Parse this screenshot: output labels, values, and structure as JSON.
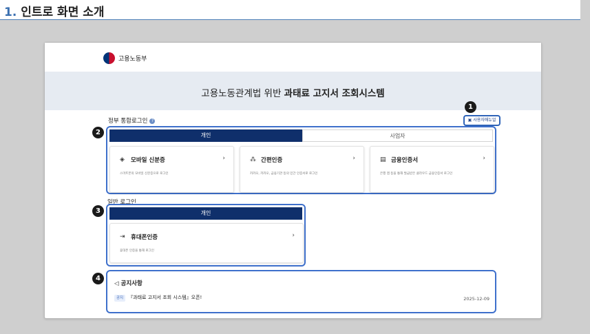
{
  "slide": {
    "number": "1.",
    "title": "인트로 화면 소개"
  },
  "header": {
    "logo_text": "고용노동부"
  },
  "banner": {
    "prefix": "고용노동관계법 위반 ",
    "emphasis": "과태료 고지서 조회시스템"
  },
  "gov_login": {
    "label": "정부 통합로그인",
    "help_icon": "?",
    "manual_link": "사용자매뉴얼",
    "tabs": [
      {
        "label": "개인",
        "active": true
      },
      {
        "label": "사업자",
        "active": false
      }
    ],
    "cards": [
      {
        "icon": "mobile-id-icon",
        "glyph": "🆔",
        "title": "모바일 신분증",
        "desc": "스마트폰의 모바일 신분증으로 로그인"
      },
      {
        "icon": "simple-auth-icon",
        "glyph": "▣",
        "title": "간편인증",
        "desc": "카카오, 카카오, 금융기관 등의 민간 인증서로 로그인"
      },
      {
        "icon": "certificate-icon",
        "glyph": "▤",
        "title": "금융인증서",
        "desc": "은행 앱 등을 통해 발급받은 클라우드 금융인증서 로그인"
      }
    ]
  },
  "general_login": {
    "label": "일반 로그인",
    "tab": "개인",
    "card": {
      "icon": "phone-auth-icon",
      "glyph": "⇥",
      "title": "휴대폰인증",
      "desc": "휴대폰 인증을 통해 로그인"
    }
  },
  "notice": {
    "icon": "megaphone-icon",
    "title": "공지사항",
    "tag": "공지",
    "item": "『과태료 고지서 조회 시스템』오픈!",
    "date": "2025-12-09"
  },
  "badges": [
    "1",
    "2",
    "3",
    "4"
  ],
  "colors": {
    "accent": "#3d6fcb",
    "navy": "#0f2f6b",
    "banner": "#e6ebf2"
  }
}
